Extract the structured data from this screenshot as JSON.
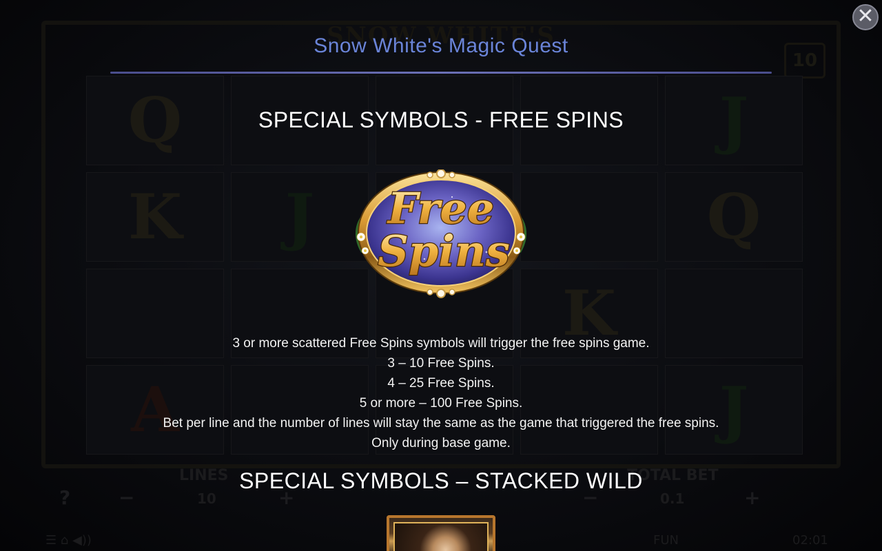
{
  "background": {
    "game_title": "SNOW WHITE'S",
    "badge_value": "10",
    "reel_symbols": [
      "Q",
      "",
      "",
      "",
      "J",
      "K",
      "J",
      "",
      "",
      "Q",
      "",
      "",
      "",
      "K",
      "",
      "A",
      "",
      "",
      "",
      "J"
    ],
    "lines_label": "LINES",
    "lines_value": "10",
    "total_bet_label": "TOTAL BET",
    "total_bet_value": "0.1",
    "status_fun": "FUN",
    "status_time": "02:01"
  },
  "popup": {
    "title": "Snow White's Magic Quest",
    "close_icon": "close-icon"
  },
  "sections": {
    "free_spins": {
      "heading": "SPECIAL SYMBOLS - FREE SPINS",
      "emblem_line1": "Free",
      "emblem_line2": "Spins",
      "lines": [
        "3 or more scattered Free Spins symbols will trigger the free spins game.",
        "3 – 10 Free Spins.",
        "4 – 25 Free Spins.",
        "5 or more – 100 Free Spins.",
        "Bet per line and the number of lines will stay the same as the game that triggered the free spins.",
        "Only during base game."
      ]
    },
    "stacked_wild": {
      "heading": "SPECIAL SYMBOLS – STACKED WILD"
    }
  },
  "colors": {
    "title": "#6a84d8",
    "rule": "#6b70b6",
    "text": "#ffffff",
    "gold": "#e8b04a"
  }
}
